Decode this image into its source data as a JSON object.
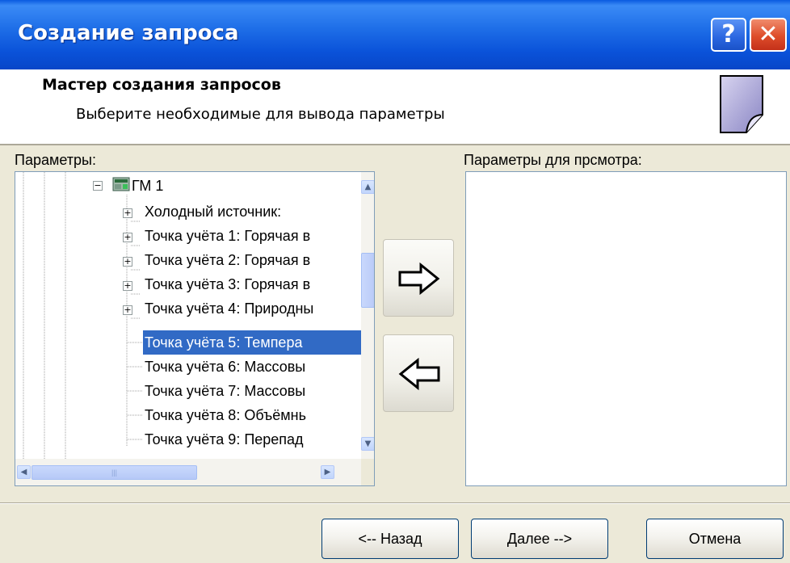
{
  "window": {
    "title": "Создание запроса",
    "help_label": "?",
    "close_label": "✕"
  },
  "header": {
    "title": "Мастер создания запросов",
    "subtitle": "Выберите необходимые для вывода параметры",
    "icon": "page-curl-icon"
  },
  "left_panel": {
    "label": "Параметры:",
    "tree": [
      {
        "label": "ГМ 1",
        "expander": "−",
        "icon": "device-icon"
      },
      {
        "label": "Холодный источник:",
        "expander": "+"
      },
      {
        "label": "Точка учёта 1: Горячая в",
        "expander": "+"
      },
      {
        "label": "Точка учёта 2: Горячая в",
        "expander": "+"
      },
      {
        "label": "Точка учёта 3: Горячая в",
        "expander": "+"
      },
      {
        "label": "Точка учёта 4: Природны",
        "expander": "+"
      },
      {
        "label": "Точка учёта 5: Темпера",
        "selected": true
      },
      {
        "label": "Точка учёта 6: Массовы"
      },
      {
        "label": "Точка учёта 7: Массовы"
      },
      {
        "label": "Точка учёта 8: Объёмнь"
      },
      {
        "label": "Точка учёта 9: Перепад"
      }
    ]
  },
  "right_panel": {
    "label": "Параметры для прсмотра:",
    "items": []
  },
  "buttons": {
    "back": "<-- Назад",
    "next": "Далее -->",
    "cancel": "Отмена"
  },
  "colors": {
    "titlebar": "#0a52d9",
    "selection": "#316ac5",
    "dialog_bg": "#ece9d8"
  }
}
